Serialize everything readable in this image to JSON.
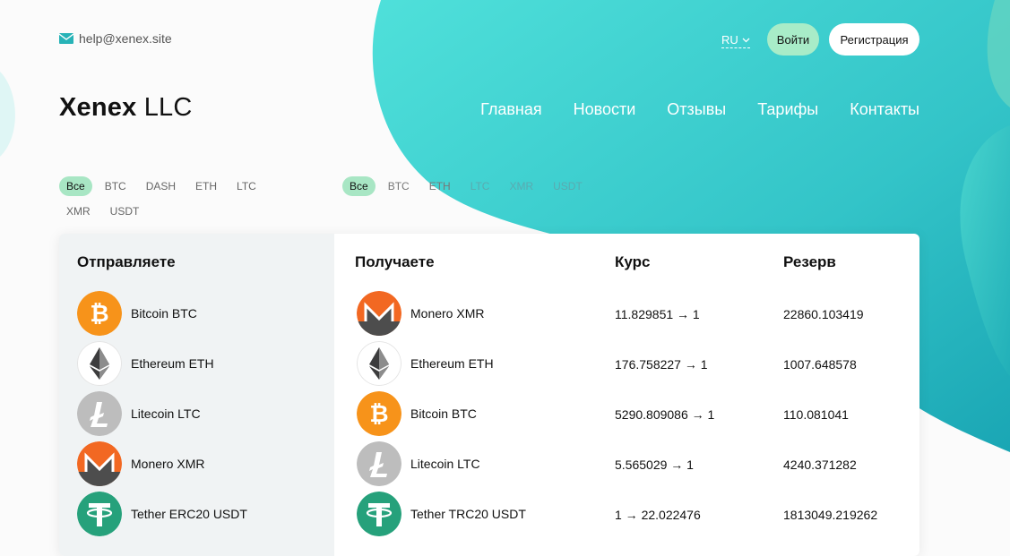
{
  "header": {
    "email": "help@xenex.site",
    "lang": "RU",
    "login_label": "Войти",
    "register_label": "Регистрация"
  },
  "logo": {
    "bold": "Xenex",
    "rest": " LLC"
  },
  "nav": [
    "Главная",
    "Новости",
    "Отзывы",
    "Тарифы",
    "Контакты"
  ],
  "filters_send": [
    "Все",
    "BTC",
    "DASH",
    "ETH",
    "LTC",
    "XMR",
    "USDT"
  ],
  "filters_receive": [
    "Все",
    "BTC",
    "ETH",
    "LTC",
    "XMR",
    "USDT"
  ],
  "table": {
    "headers": {
      "send": "Отправляете",
      "receive": "Получаете",
      "rate": "Курс",
      "reserve": "Резерв"
    },
    "send": [
      {
        "name": "Bitcoin BTC",
        "icon": "bitcoin-icon"
      },
      {
        "name": "Ethereum ETH",
        "icon": "ethereum-icon"
      },
      {
        "name": "Litecoin LTC",
        "icon": "litecoin-icon"
      },
      {
        "name": "Monero XMR",
        "icon": "monero-icon"
      },
      {
        "name": "Tether ERC20 USDT",
        "icon": "tether-icon"
      }
    ],
    "receive": [
      {
        "name": "Monero XMR",
        "icon": "monero-icon",
        "rate": "11.829851 → 1",
        "reserve": "22860.103419"
      },
      {
        "name": "Ethereum ETH",
        "icon": "ethereum-icon",
        "rate": "176.758227 → 1",
        "reserve": "1007.648578"
      },
      {
        "name": "Bitcoin BTC",
        "icon": "bitcoin-icon",
        "rate": "5290.809086 → 1",
        "reserve": "110.081041"
      },
      {
        "name": "Litecoin LTC",
        "icon": "litecoin-icon",
        "rate": "5.565029 → 1",
        "reserve": "4240.371282"
      },
      {
        "name": "Tether TRC20 USDT",
        "icon": "tether-icon",
        "rate": "1 → 22.022476",
        "reserve": "1813049.219262"
      }
    ]
  },
  "colors": {
    "accent_teal": "#3fd0cf",
    "accent_green": "#a8ecc8",
    "bitcoin": "#f7931a",
    "monero": "#f26822",
    "tether": "#26a17b",
    "litecoin": "#bdbdbd"
  }
}
